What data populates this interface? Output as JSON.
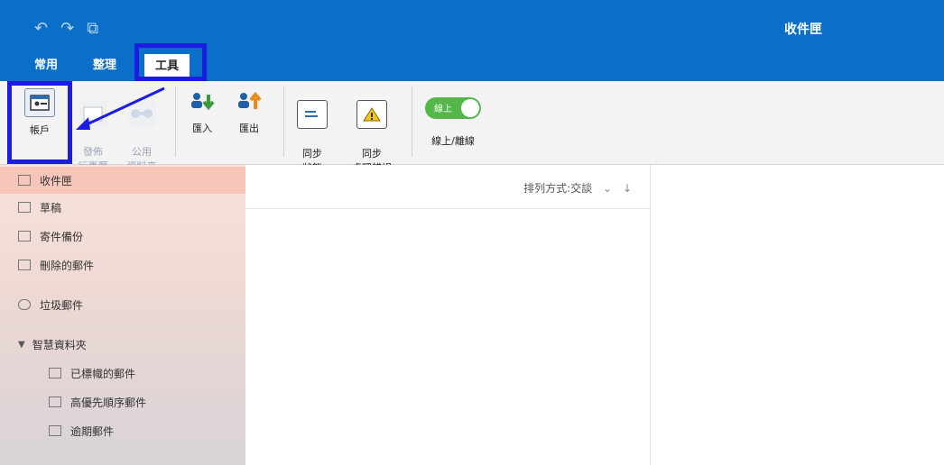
{
  "window": {
    "title": "收件匣"
  },
  "quick_access": [
    {
      "icon": "undo-icon",
      "glyph": "↶"
    },
    {
      "icon": "redo-icon",
      "glyph": "↷"
    },
    {
      "icon": "new-window-icon",
      "glyph": "⧉"
    }
  ],
  "tabs": [
    {
      "label": "常用",
      "active": false
    },
    {
      "label": "整理",
      "active": false
    },
    {
      "label": "工具",
      "active": true
    }
  ],
  "ribbon": {
    "accounts": "帳戶",
    "publish_calendar": "發佈\n行事曆",
    "public_folders": "公用\n資料夾",
    "import": "匯入",
    "export": "匯出",
    "sync_status": "同步\n狀態",
    "sync_errors": "同步\n處理錯誤",
    "online_toggle_text": "線上",
    "online_offline": "線上/離線"
  },
  "sidebar": {
    "items": [
      {
        "label": "收件匣",
        "icon": "inbox-icon",
        "selected": true
      },
      {
        "label": "草稿",
        "icon": "drafts-icon"
      },
      {
        "label": "寄件備份",
        "icon": "sent-icon"
      },
      {
        "label": "刪除的郵件",
        "icon": "trash-icon"
      },
      {
        "label": "垃圾郵件",
        "icon": "junk-icon"
      }
    ],
    "smart_folders_header": "智慧資料夾",
    "smart_folders": [
      {
        "label": "已標幟的郵件",
        "icon": "folder-icon"
      },
      {
        "label": "高優先順序郵件",
        "icon": "folder-icon"
      },
      {
        "label": "逾期郵件",
        "icon": "folder-icon"
      }
    ]
  },
  "message_list": {
    "sort_label": "排列方式:交談",
    "sort_dropdown_glyph": "⌄",
    "sort_direction_glyph": "↓"
  },
  "colors": {
    "titlebar": "#0a6fc9",
    "highlight": "#1c1ce0",
    "selected": "#f6c6bb",
    "toggle": "#53b74a"
  }
}
